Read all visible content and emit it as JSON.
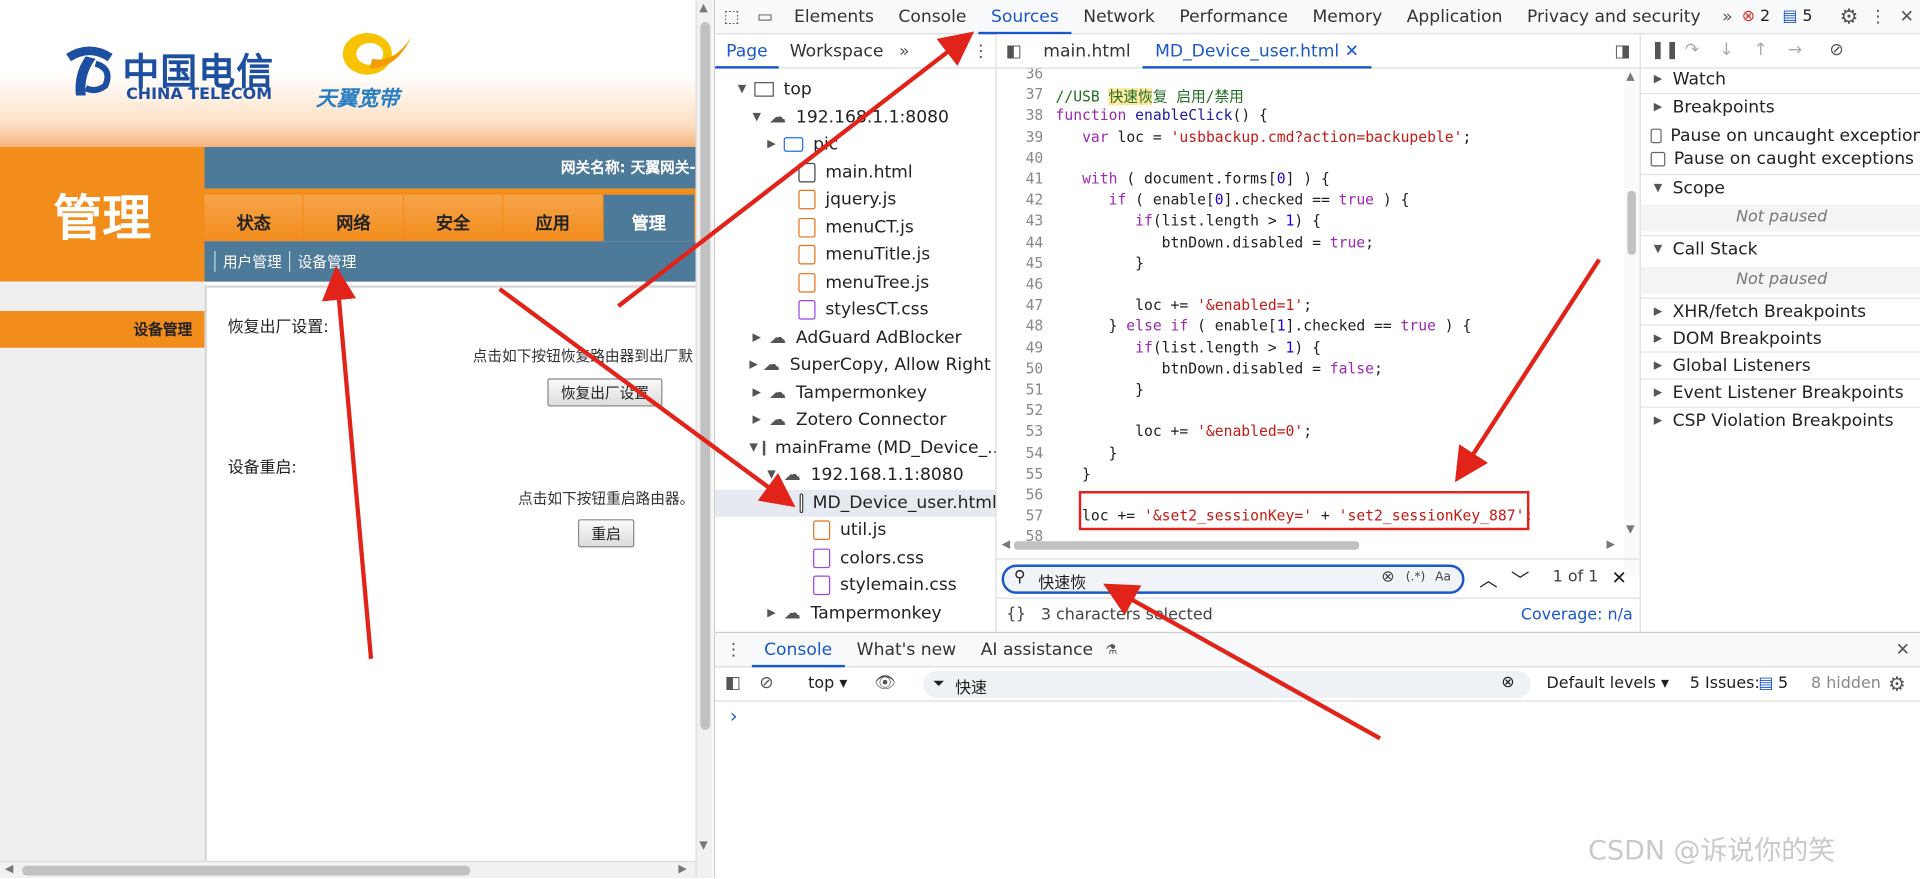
{
  "router": {
    "logo_ct_zh": "中国电信",
    "logo_ct_en": "CHINA TELECOM",
    "logo_ty": "天翼宽带",
    "manage_title": "管理",
    "gateway_label": "网关名称:   天翼网关-",
    "tabs": [
      "状态",
      "网络",
      "安全",
      "应用",
      "管理"
    ],
    "subnav": [
      "用户管理",
      "设备管理"
    ],
    "side_item": "设备管理",
    "factory_label": "恢复出厂设置:",
    "factory_desc": "点击如下按钮恢复路由器到出厂默",
    "factory_btn": "恢复出厂设置",
    "reboot_label": "设备重启:",
    "reboot_desc": "点击如下按钮重启路由器。",
    "reboot_btn": "重启"
  },
  "devtools": {
    "main_tabs": [
      "Elements",
      "Console",
      "Sources",
      "Network",
      "Performance",
      "Memory",
      "Application",
      "Privacy and security"
    ],
    "more": "»",
    "error_count": "2",
    "issue_count": "5",
    "nav_tabs": [
      "Page",
      "Workspace"
    ],
    "tree": [
      {
        "label": "top",
        "type": "frame",
        "indent": 0,
        "open": true
      },
      {
        "label": "192.168.1.1:8080",
        "type": "cloud",
        "indent": 1,
        "open": true
      },
      {
        "label": "pic",
        "type": "folder",
        "indent": 2,
        "open": false
      },
      {
        "label": "main.html",
        "type": "html",
        "indent": 3
      },
      {
        "label": "jquery.js",
        "type": "js",
        "indent": 3
      },
      {
        "label": "menuCT.js",
        "type": "js",
        "indent": 3
      },
      {
        "label": "menuTitle.js",
        "type": "js",
        "indent": 3
      },
      {
        "label": "menuTree.js",
        "type": "js",
        "indent": 3
      },
      {
        "label": "stylesCT.css",
        "type": "css",
        "indent": 3
      },
      {
        "label": "AdGuard AdBlocker",
        "type": "cloud",
        "indent": 1,
        "open": false
      },
      {
        "label": "SuperCopy, Allow Right ...",
        "type": "cloud",
        "indent": 1,
        "open": false
      },
      {
        "label": "Tampermonkey",
        "type": "cloud",
        "indent": 1,
        "open": false
      },
      {
        "label": "Zotero Connector",
        "type": "cloud",
        "indent": 1,
        "open": false
      },
      {
        "label": "mainFrame (MD_Device_...",
        "type": "frame",
        "indent": 1,
        "open": true
      },
      {
        "label": "192.168.1.1:8080",
        "type": "cloud",
        "indent": 2,
        "open": true
      },
      {
        "label": "MD_Device_user.html",
        "type": "html",
        "indent": 4,
        "selected": true
      },
      {
        "label": "util.js",
        "type": "js",
        "indent": 4
      },
      {
        "label": "colors.css",
        "type": "css",
        "indent": 4
      },
      {
        "label": "stylemain.css",
        "type": "css",
        "indent": 4
      },
      {
        "label": "Tampermonkey",
        "type": "cloud",
        "indent": 2,
        "open": false
      }
    ],
    "editor_tabs": [
      "main.html",
      "MD_Device_user.html"
    ],
    "code_lines": [
      {
        "n": "36",
        "html": ""
      },
      {
        "n": "37",
        "html": "<span class=\"cm\">//USB <span class=\"hl\">快速恢</span>复 启用/禁用</span>"
      },
      {
        "n": "38",
        "html": "<span class=\"kw\">function</span> <span class=\"fn\">enableClick</span>() {"
      },
      {
        "n": "39",
        "html": "   <span class=\"kw\">var</span> loc = <span class=\"st\">'usbbackup.cmd?action=backupeble'</span>;"
      },
      {
        "n": "40",
        "html": ""
      },
      {
        "n": "41",
        "html": "   <span class=\"kw\">with</span> ( document.forms[<span class=\"nb\">0</span>] ) {"
      },
      {
        "n": "42",
        "html": "      <span class=\"kw\">if</span> ( enable[<span class=\"nb\">0</span>].checked == <span class=\"kw\">true</span> ) {"
      },
      {
        "n": "43",
        "html": "         <span class=\"kw\">if</span>(list.length > <span class=\"nb\">1</span>) {"
      },
      {
        "n": "44",
        "html": "            btnDown.disabled = <span class=\"kw\">true</span>;"
      },
      {
        "n": "45",
        "html": "         }"
      },
      {
        "n": "46",
        "html": ""
      },
      {
        "n": "47",
        "html": "         loc += <span class=\"st\">'&amp;enabled=1'</span>;"
      },
      {
        "n": "48",
        "html": "      } <span class=\"kw\">else if</span> ( enable[<span class=\"nb\">1</span>].checked == <span class=\"kw\">true</span> ) {"
      },
      {
        "n": "49",
        "html": "         <span class=\"kw\">if</span>(list.length > <span class=\"nb\">1</span>) {"
      },
      {
        "n": "50",
        "html": "            btnDown.disabled = <span class=\"kw\">false</span>;"
      },
      {
        "n": "51",
        "html": "         }"
      },
      {
        "n": "52",
        "html": ""
      },
      {
        "n": "53",
        "html": "         loc += <span class=\"st\">'&amp;enabled=0'</span>;"
      },
      {
        "n": "54",
        "html": "      }"
      },
      {
        "n": "55",
        "html": "   }"
      },
      {
        "n": "56",
        "html": ""
      },
      {
        "n": "57",
        "html": "   loc += <span class=\"st\">'&amp;set2_sessionKey='</span> + <span class=\"st\">'set2_sessionKey_887'</span>;"
      },
      {
        "n": "58",
        "html": ""
      }
    ],
    "search_value": "快速恢",
    "search_regex": "(.*)",
    "search_case": "Aa",
    "search_count": "1 of 1",
    "status_text": "3 characters selected",
    "coverage": "Coverage: n/a",
    "right_panes": {
      "watch": "Watch",
      "breakpoints": "Breakpoints",
      "pause_uncaught": "Pause on uncaught exceptions",
      "pause_caught": "Pause on caught exceptions",
      "scope": "Scope",
      "scope_state": "Not paused",
      "callstack": "Call Stack",
      "callstack_state": "Not paused",
      "xhr": "XHR/fetch Breakpoints",
      "dom": "DOM Breakpoints",
      "global": "Global Listeners",
      "event": "Event Listener Breakpoints",
      "csp": "CSP Violation Breakpoints"
    },
    "drawer_tabs": [
      "Console",
      "What's new",
      "AI assistance"
    ],
    "context": "top",
    "filter_value": "快速",
    "levels": "Default levels",
    "issues_label": "5 Issues:",
    "issues_count": "5",
    "hidden": "8 hidden",
    "prompt": "›"
  },
  "watermark": "CSDN @诉说你的笑",
  "colors": {
    "accent": "#1a57c9",
    "orange": "#f28d1c",
    "router_blue": "#4e7a9a",
    "annotation_red": "#e2231a"
  }
}
